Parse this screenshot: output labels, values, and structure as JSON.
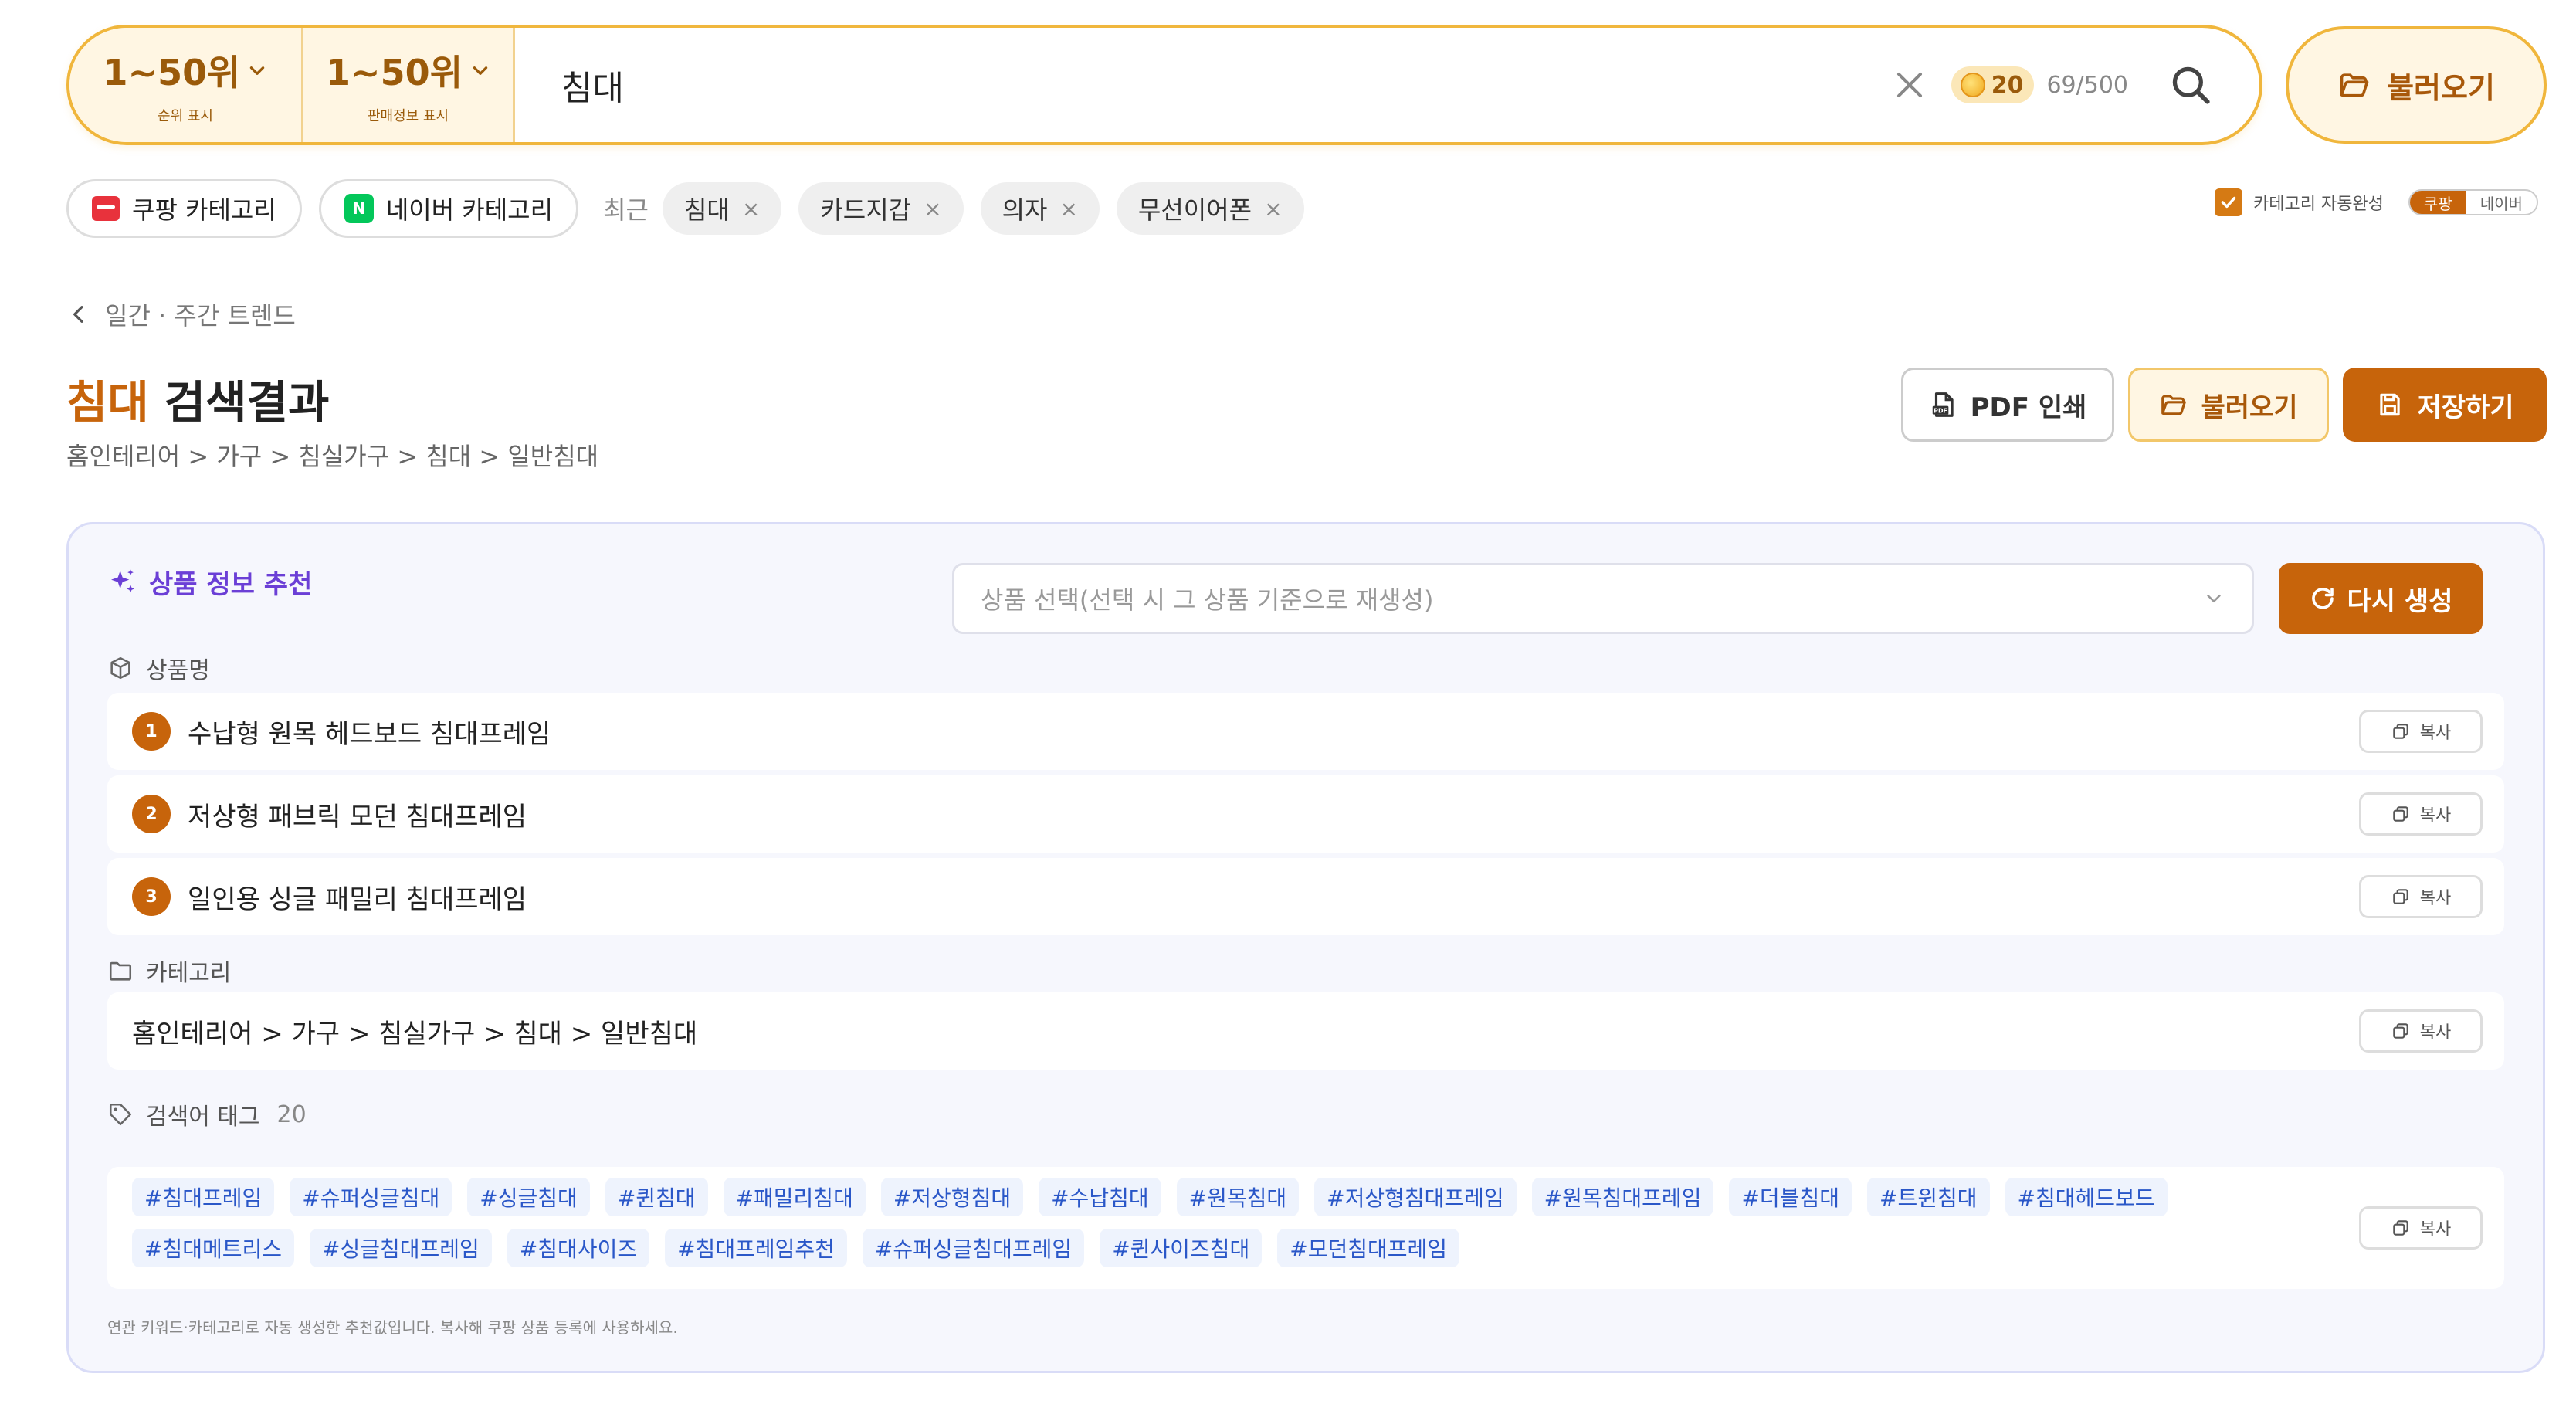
{
  "search": {
    "rank_range": "1~50위",
    "rank_sub": "순위 표시",
    "sales_range": "1~50위",
    "sales_sub": "판매정보 표시",
    "query": "침대",
    "coin_count": "20",
    "usage": "69/500",
    "load_label": "불러오기"
  },
  "filters": {
    "coupang_category": "쿠팡 카테고리",
    "naver_category": "네이버 카테고리",
    "naver_logo": "N",
    "recent_label": "최근",
    "recent_chips": [
      "침대",
      "카드지갑",
      "의자",
      "무선이어폰"
    ],
    "chip_close": "×",
    "auto_complete_label": "카테고리 자동완성",
    "toggle_coupang": "쿠팡",
    "toggle_naver": "네이버"
  },
  "page": {
    "back_label": "일간 · 주간 트렌드",
    "title_keyword": "침대",
    "title_suffix": " 검색결과",
    "category_path": "홈인테리어 > 가구 > 침실가구 > 침대 > 일반침대",
    "pdf_label": "PDF 인쇄",
    "load_label": "불러오기",
    "save_label": "저장하기"
  },
  "recommend": {
    "title": "상품 정보 추천",
    "select_placeholder": "상품 선택(선택 시 그 상품 기준으로 재생성)",
    "regen_label": "다시 생성",
    "product_name_label": "상품명",
    "product_names": [
      {
        "num": "1",
        "text": "수납형 원목 헤드보드 침대프레임"
      },
      {
        "num": "2",
        "text": "저상형 패브릭 모던 침대프레임"
      },
      {
        "num": "3",
        "text": "일인용 싱글 패밀리 침대프레임"
      }
    ],
    "category_label": "카테고리",
    "category_value": "홈인테리어 > 가구 > 침실가구 > 침대 > 일반침대",
    "tags_label": "검색어 태그",
    "tags_count": "20",
    "tags": [
      "#침대프레임",
      "#슈퍼싱글침대",
      "#싱글침대",
      "#퀸침대",
      "#패밀리침대",
      "#저상형침대",
      "#수납침대",
      "#원목침대",
      "#저상형침대프레임",
      "#원목침대프레임",
      "#더블침대",
      "#트윈침대",
      "#침대헤드보드",
      "#침대메트리스",
      "#싱글침대프레임",
      "#침대사이즈",
      "#침대프레임추천",
      "#슈퍼싱글침대프레임",
      "#퀸사이즈침대",
      "#모던침대프레임"
    ],
    "copy_label": "복사",
    "footnote": "연관 키워드·카테고리로 자동 생성한 추천값입니다. 복사해 쿠팡 상품 등록에 사용하세요."
  },
  "colors": {
    "accent": "#c7640b",
    "accent_light": "#fff6e3",
    "border_gold": "#f0b63c",
    "purple": "#6b3fd6",
    "tag_blue": "#2a57c8"
  }
}
